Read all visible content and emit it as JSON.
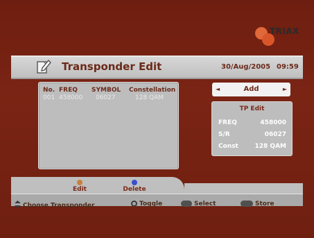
{
  "brand": {
    "name": "TRIAX"
  },
  "header": {
    "title": "Transponder Edit",
    "date": "30/Aug/2005",
    "time": "09:59",
    "icon": "edit-document-icon"
  },
  "transponder_list": {
    "columns": [
      "No.",
      "FREQ",
      "SYMBOL",
      "Constellation"
    ],
    "rows": [
      {
        "no": "001",
        "freq": "458000",
        "symbol": "06027",
        "constellation": "128 QAM"
      }
    ]
  },
  "mode_selector": {
    "value": "Add",
    "left_arrow": "◄",
    "right_arrow": "►"
  },
  "tp_edit": {
    "title": "TP Edit",
    "fields": [
      {
        "label": "FREQ",
        "value": "458000"
      },
      {
        "label": "S/R",
        "value": "06027"
      },
      {
        "label": "Const",
        "value": "128 QAM"
      }
    ]
  },
  "color_keys": [
    {
      "label": "Edit",
      "color": "#c9803a"
    },
    {
      "label": "Delete",
      "color": "#3a4fd0"
    }
  ],
  "hints": [
    {
      "label": "Choose Transponder",
      "icon": "up-down-icon"
    },
    {
      "label": "Toggle",
      "icon": "o-button-icon"
    },
    {
      "label": "Select",
      "icon": "ok-button-icon"
    },
    {
      "label": "Store",
      "icon": "store-button-icon"
    }
  ],
  "colors": {
    "background": "#7a2414",
    "panel": "#bdbdbd",
    "accent_text": "#6b2a1a"
  }
}
